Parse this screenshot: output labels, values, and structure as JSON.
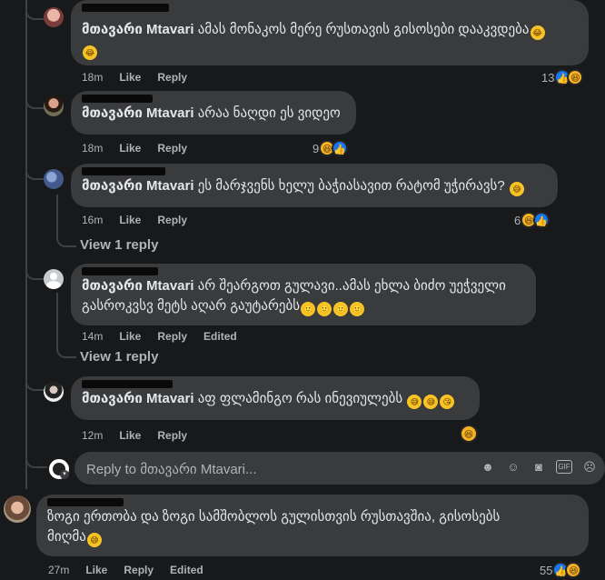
{
  "colors": {
    "bg": "#18191a",
    "bubble": "#3a3b3c",
    "meta": "#b0b3b8",
    "like": "#1877f2",
    "haha": "#f7b125"
  },
  "page_name": "მთავარი Mtavari",
  "comments": [
    {
      "text": "ამას მონაკოს მერე რუსთავის გისოსები დააკვდება",
      "time": "18m",
      "like": "Like",
      "reply": "Reply",
      "count": "13",
      "emoji_trail": "🤣🤣"
    },
    {
      "text": "არაა ნაღდი ეს ვიდეო",
      "time": "18m",
      "like": "Like",
      "reply": "Reply",
      "count": "9"
    },
    {
      "text": "ეს მარჯვენს ხელუ ბაჭიასავით რატომ უჭირავს?",
      "time": "16m",
      "like": "Like",
      "reply": "Reply",
      "count": "6",
      "view_reply": "View 1 reply"
    },
    {
      "text_line1": "არ შეარგოთ გულავი..ამას ეხლა ბიძო უეჭველი",
      "text_line2": "გასროკვსვ მეტს აღარ გაუტარებს",
      "time": "14m",
      "like": "Like",
      "reply": "Reply",
      "edited": "Edited",
      "view_reply": "View 1 reply"
    },
    {
      "text": "აფ ფლამინგო რას ინევიულებს",
      "time": "12m",
      "like": "Like",
      "reply": "Reply"
    }
  ],
  "reply_box": {
    "placeholder": "Reply to მთავარი Mtavari...",
    "icons": [
      "sticker-icon",
      "emoji-icon",
      "camera-icon",
      "gif-icon",
      "sticker2-icon"
    ]
  },
  "bottom_comment": {
    "line1": "ზოგი ერთობა და ზოგი სამშობლოს გულისთვის რუსთავშია, გისოსებს",
    "line2": "მიღმა",
    "time": "27m",
    "like": "Like",
    "reply": "Reply",
    "edited": "Edited",
    "count": "55"
  }
}
